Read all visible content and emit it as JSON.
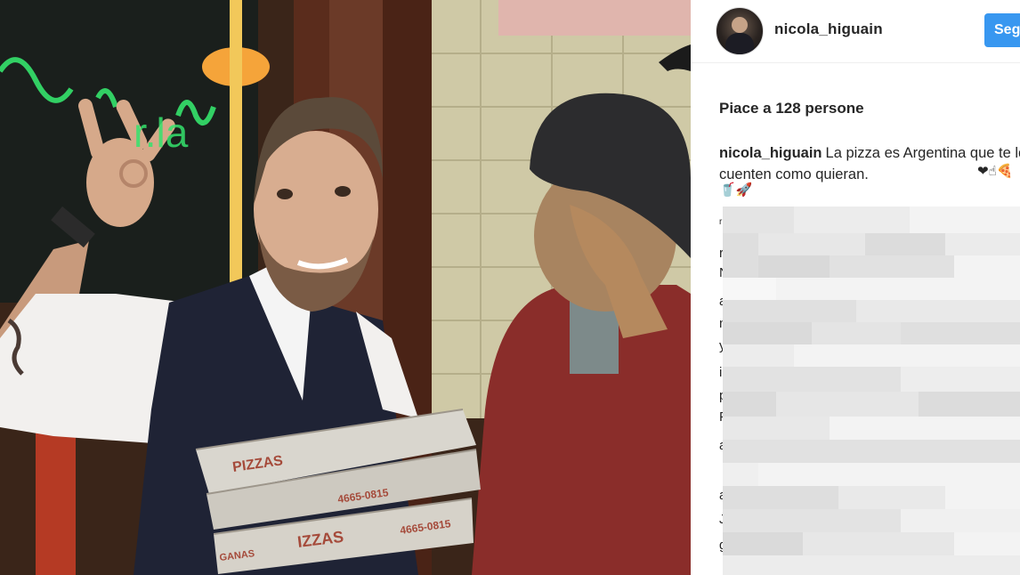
{
  "post": {
    "username": "nicola_higuain",
    "follow_label": "Seg",
    "likes_text": "Piace a 128 persone",
    "caption_user": "nicola_higuain",
    "caption_text": "La pizza es Argentina que te lo cuenten como quieran.",
    "caption_emoji": "❤☝🍕",
    "caption_emoji_line2": "🥤🚀"
  },
  "photo": {
    "neon_text": "r.la",
    "box_label_1": "PIZZAS",
    "box_label_2": "4665-0815",
    "box_label_3": "IZZAS",
    "box_label_4": "4665-0815",
    "box_label_5": "GANAS"
  },
  "comments": [
    "r",
    "N",
    "a",
    "n",
    "y",
    "i",
    "p",
    "F",
    "a",
    "a",
    "J",
    "g"
  ],
  "colors": {
    "follow_bg": "#3897f0",
    "text": "#262626"
  }
}
